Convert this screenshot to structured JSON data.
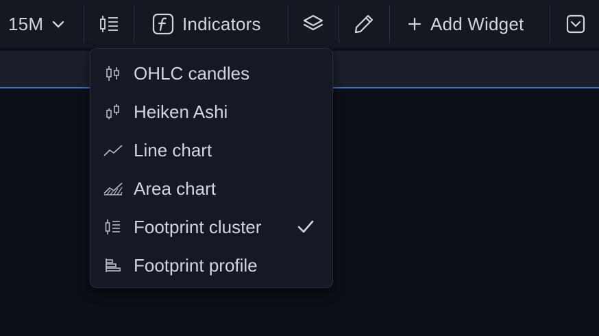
{
  "toolbar": {
    "timeframe_label": "15M",
    "indicators_label": "Indicators",
    "add_widget_label": "Add Widget",
    "add_widget_prefix": "+"
  },
  "chart_type_menu": {
    "items": [
      {
        "label": "OHLC candles",
        "icon": "ohlc-candles-icon",
        "selected": false
      },
      {
        "label": "Heiken Ashi",
        "icon": "heiken-ashi-icon",
        "selected": false
      },
      {
        "label": "Line chart",
        "icon": "line-chart-icon",
        "selected": false
      },
      {
        "label": "Area chart",
        "icon": "area-chart-icon",
        "selected": false
      },
      {
        "label": "Footprint cluster",
        "icon": "footprint-cluster-icon",
        "selected": true
      },
      {
        "label": "Footprint profile",
        "icon": "footprint-profile-icon",
        "selected": false
      }
    ]
  },
  "colors": {
    "toolbar_bg": "#141820",
    "menu_bg": "#151923",
    "accent": "#3b6fd6",
    "text": "#d3d6dc"
  }
}
